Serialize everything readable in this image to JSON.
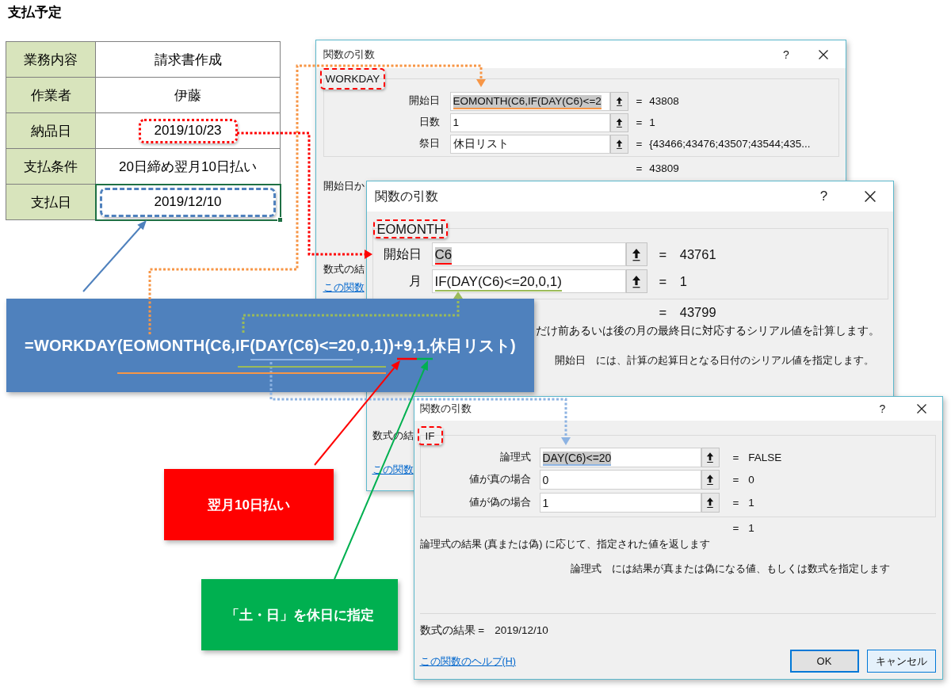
{
  "page_title": "支払予定",
  "table": {
    "rows": [
      {
        "label": "業務内容",
        "value": "請求書作成",
        "selected": false,
        "kind": "plain"
      },
      {
        "label": "作業者",
        "value": "伊藤",
        "selected": false,
        "kind": "plain"
      },
      {
        "label": "納品日",
        "value": "2019/10/23",
        "selected": false,
        "kind": "dotted",
        "color": "#ff0000"
      },
      {
        "label": "支払条件",
        "value": "20日締め翌月10日払い",
        "selected": false,
        "kind": "plain"
      },
      {
        "label": "支払日",
        "value": "2019/12/10",
        "selected": true,
        "kind": "dashed",
        "color": "#4f81bd"
      }
    ]
  },
  "dialogs": [
    {
      "title": "関数の引数",
      "help": "?",
      "function": "WORKDAY",
      "arguments": [
        {
          "label": "開始日",
          "value": "EOMONTH(C6,IF(DAY(C6)<=2",
          "result": "= 43808",
          "text_selected": true,
          "color": "#f79646"
        },
        {
          "label": "日数",
          "value": "1",
          "result": "= 1",
          "text_selected": false
        },
        {
          "label": "祭日",
          "value": "休日リスト",
          "result": "= {43466;43476;43507;43544;435...",
          "text_selected": false
        }
      ],
      "result": "= 43809",
      "description": "開始日か",
      "formula_result_label": "数式の結",
      "help_link": "この関数"
    },
    {
      "title": "関数の引数",
      "help": "?",
      "function": "EOMONTH",
      "arguments": [
        {
          "label": "開始日",
          "value": "C6",
          "result": "= 43761",
          "text_selected": true,
          "color": "#ff0000"
        },
        {
          "label": "月",
          "value": "IF(DAY(C6)<=20,0,1)",
          "result": "= 1",
          "text_selected": false,
          "color": "#9bbb59"
        }
      ],
      "result": "= 43799",
      "description": "だけ前あるいは後の月の最終日に対応するシリアル値を計算します。",
      "argument_help": "開始日　には、計算の起算日となる日付のシリアル値を指定します。",
      "formula_result_label": "数式の結",
      "help_link": "この関数"
    },
    {
      "title": "関数の引数",
      "help": "?",
      "function": "IF",
      "arguments": [
        {
          "label": "論理式",
          "value": "DAY(C6)<=20",
          "result": "= FALSE",
          "text_selected": true,
          "color": "#8db3e2"
        },
        {
          "label": "値が真の場合",
          "value": "0",
          "result": "= 0",
          "text_selected": false
        },
        {
          "label": "値が偽の場合",
          "value": "1",
          "result": "= 1",
          "text_selected": false
        }
      ],
      "result": "= 1",
      "description": "論理式の結果 (真または偽) に応じて、指定された値を返します",
      "argument_help": "論理式　には結果が真または偽になる値、もしくは数式を指定します",
      "formula_result_label": "数式の結果 =",
      "formula_result": "2019/12/10",
      "help_link": "この関数のヘルプ(H)",
      "buttons": [
        {
          "label": "OK",
          "default": true
        },
        {
          "label": "キャンセル",
          "default": false
        }
      ]
    }
  ],
  "formula": {
    "text": "=WORKDAY(EOMONTH(C6,IF(DAY(C6)<=20,0,1))+9,1,休日リスト)"
  },
  "callouts": [
    {
      "text": "翌月10日払い",
      "color": "#ff0000"
    },
    {
      "text": "「土・日」を休日に指定",
      "color": "#00b050"
    }
  ]
}
